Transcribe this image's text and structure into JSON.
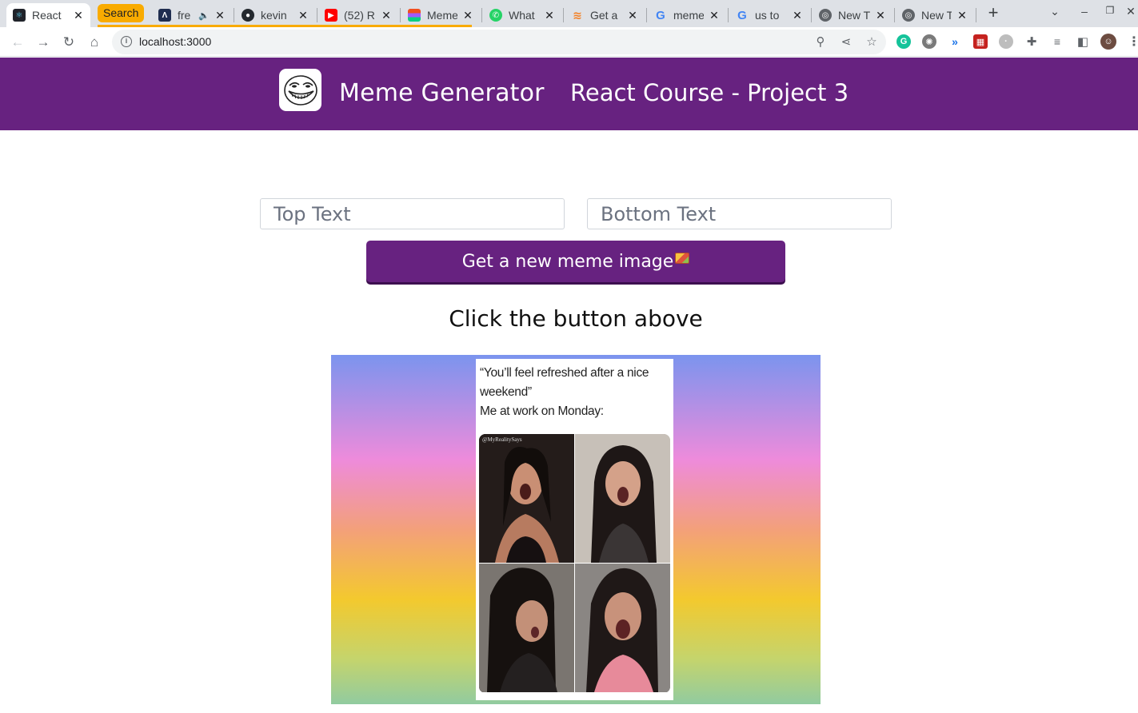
{
  "browser": {
    "tabs": [
      {
        "title": "React",
        "favicon": "react-icon",
        "active": true
      },
      {
        "title": "fre",
        "favicon": "a-icon",
        "muted": true
      },
      {
        "title": "kevin",
        "favicon": "github-icon"
      },
      {
        "title": "(52) R",
        "favicon": "youtube-icon"
      },
      {
        "title": "Meme",
        "favicon": "figma-icon"
      },
      {
        "title": "What",
        "favicon": "whatsapp-icon"
      },
      {
        "title": "Get a",
        "favicon": "stackoverflow-icon"
      },
      {
        "title": "meme",
        "favicon": "google-icon"
      },
      {
        "title": "us to",
        "favicon": "google-icon"
      },
      {
        "title": "New T",
        "favicon": "chrome-icon"
      },
      {
        "title": "New T",
        "favicon": "chrome-icon"
      }
    ],
    "search_pill": "Search",
    "url": "localhost:3000"
  },
  "header": {
    "brand": "Meme Generator",
    "project": "React Course - Project 3"
  },
  "form": {
    "top_placeholder": "Top Text",
    "bottom_placeholder": "Bottom Text",
    "button_label": "Get a new meme image"
  },
  "hint": "Click the button above",
  "meme": {
    "caption_line1": "“You’ll feel refreshed after a nice",
    "caption_line2": "weekend”",
    "caption_line3": "Me at work on Monday:",
    "watermark": "@MyRealitySays"
  },
  "colors": {
    "brand_purple": "#672280",
    "search_pill": "#f9ab00"
  }
}
